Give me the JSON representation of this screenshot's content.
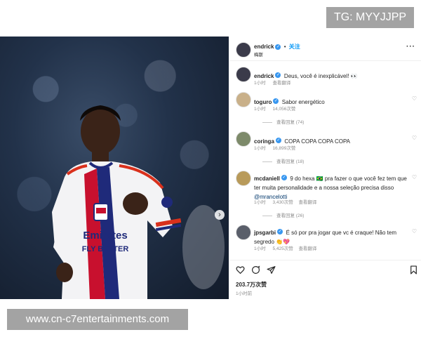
{
  "watermark": {
    "tg": "TG: MYYJJPP",
    "site": "www.cn-c7entertainments.com"
  },
  "post": {
    "author": "endrick",
    "follow_label": "关注",
    "separator": "•",
    "subtitle": "梅斯",
    "more": "···"
  },
  "comments": [
    {
      "user": "endrick",
      "text": "Deus, você é inexplicável! 👀",
      "time": "1小时",
      "likes": "",
      "translate": "查看翻译",
      "replies": ""
    },
    {
      "user": "toguro",
      "text": "Sabor energético",
      "time": "1小时",
      "likes": "14,056次赞",
      "translate": "",
      "replies": "查看回复 (74)"
    },
    {
      "user": "coringa",
      "text": "COPA COPA COPA COPA",
      "time": "1小时",
      "likes": "16,899次赞",
      "translate": "",
      "replies": "查看回复 (18)"
    },
    {
      "user": "mcdaniell",
      "text": "9 do hexa 🇧🇷 pra fazer o que você fez tem que ter muita personalidade e a nossa seleção precisa disso",
      "mention": "@mrancelotti",
      "time": "1小时",
      "likes": "3,430次赞",
      "translate": "查看翻译",
      "replies": "查看回复 (26)"
    },
    {
      "user": "jpsgarbi",
      "text": "É só por pra jogar que vc é craque! Não tem segredo 👏💖",
      "time": "1小时",
      "likes": "5,425次赞",
      "translate": "查看翻译",
      "replies": ""
    }
  ],
  "footer": {
    "likes": "203.7万次赞",
    "time": "1小时前"
  },
  "icons": [
    "heart-icon",
    "comment-icon",
    "share-icon",
    "bookmark-icon",
    "verified-icon",
    "more-icon",
    "chevron-right-icon"
  ]
}
